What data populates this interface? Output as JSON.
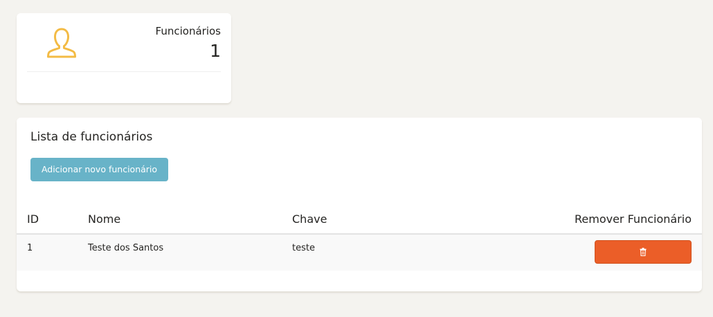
{
  "stat_card": {
    "icon": "user-icon",
    "icon_color": "#f3bb45",
    "label": "Funcionários",
    "value": "1"
  },
  "list_card": {
    "title": "Lista de funcionários",
    "add_button_label": "Adicionar novo funcionário",
    "add_button_color": "#68b3c8",
    "columns": [
      "ID",
      "Nome",
      "Chave",
      "Remover Funcionário"
    ],
    "rows": [
      {
        "id": "1",
        "nome": "Teste dos Santos",
        "chave": "teste",
        "remove_icon": "trash-icon"
      }
    ],
    "remove_button_color": "#eb5e28"
  }
}
